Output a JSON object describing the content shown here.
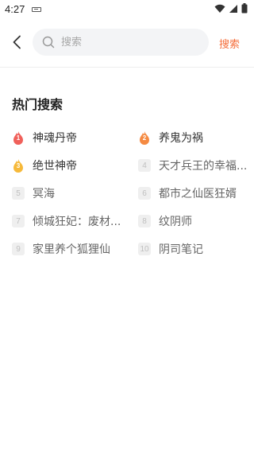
{
  "status_bar": {
    "time": "4:27"
  },
  "header": {
    "search_placeholder": "搜索",
    "search_button": "搜索"
  },
  "hot": {
    "title": "热门搜索",
    "colors": {
      "rank1": "#f0605a",
      "rank2": "#f58a42",
      "rank3": "#f6b93a",
      "accent": "#f56e3b"
    },
    "items": [
      {
        "rank": "1",
        "name": "神魂丹帝"
      },
      {
        "rank": "2",
        "name": "养鬼为祸"
      },
      {
        "rank": "3",
        "name": "绝世神帝"
      },
      {
        "rank": "4",
        "name": "天才兵王的幸福..."
      },
      {
        "rank": "5",
        "name": "冥海"
      },
      {
        "rank": "6",
        "name": "都市之仙医狂婿"
      },
      {
        "rank": "7",
        "name": "倾城狂妃：废材..."
      },
      {
        "rank": "8",
        "name": "纹阴师"
      },
      {
        "rank": "9",
        "name": "家里养个狐狸仙"
      },
      {
        "rank": "10",
        "name": "阴司笔记"
      }
    ]
  }
}
